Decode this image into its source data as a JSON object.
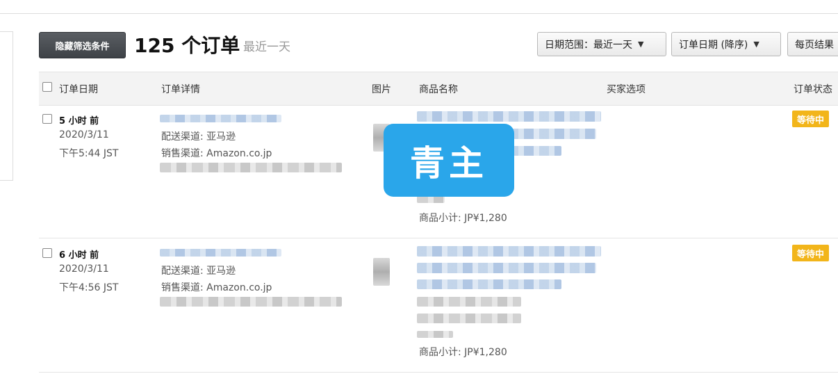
{
  "toolbar": {
    "hide_filters_label": "隐藏筛选条件",
    "order_count": "125 个订单",
    "range_subtitle": "最近一天",
    "date_range_dropdown": "日期范围：最近一天",
    "sort_dropdown": "订单日期 (降序)",
    "per_page_dropdown": "每页结果"
  },
  "table": {
    "columns": [
      "订单日期",
      "订单详情",
      "图片",
      "商品名称",
      "买家选项",
      "订单状态"
    ],
    "rows": [
      {
        "time_ago": "5 小时 前",
        "date": "2020/3/11",
        "time": "下午5:44 JST",
        "shipping": "配送渠道: 亚马逊",
        "sales_channel": "销售渠道: Amazon.co.jp",
        "subtotal": "商品小计: JP¥1,280",
        "status": "等待中"
      },
      {
        "time_ago": "6 小时 前",
        "date": "2020/3/11",
        "time": "下午4:56 JST",
        "shipping": "配送渠道: 亚马逊",
        "sales_channel": "销售渠道: Amazon.co.jp",
        "subtotal": "商品小计: JP¥1,280",
        "status": "等待中"
      }
    ]
  },
  "watermark": {
    "text": "青主"
  },
  "colors": {
    "status_badge": "#f2b51a",
    "watermark": "#2aa6ea",
    "hide_button": "#4a4e53"
  },
  "icons": {
    "dropdown": "chevron-down-icon"
  }
}
